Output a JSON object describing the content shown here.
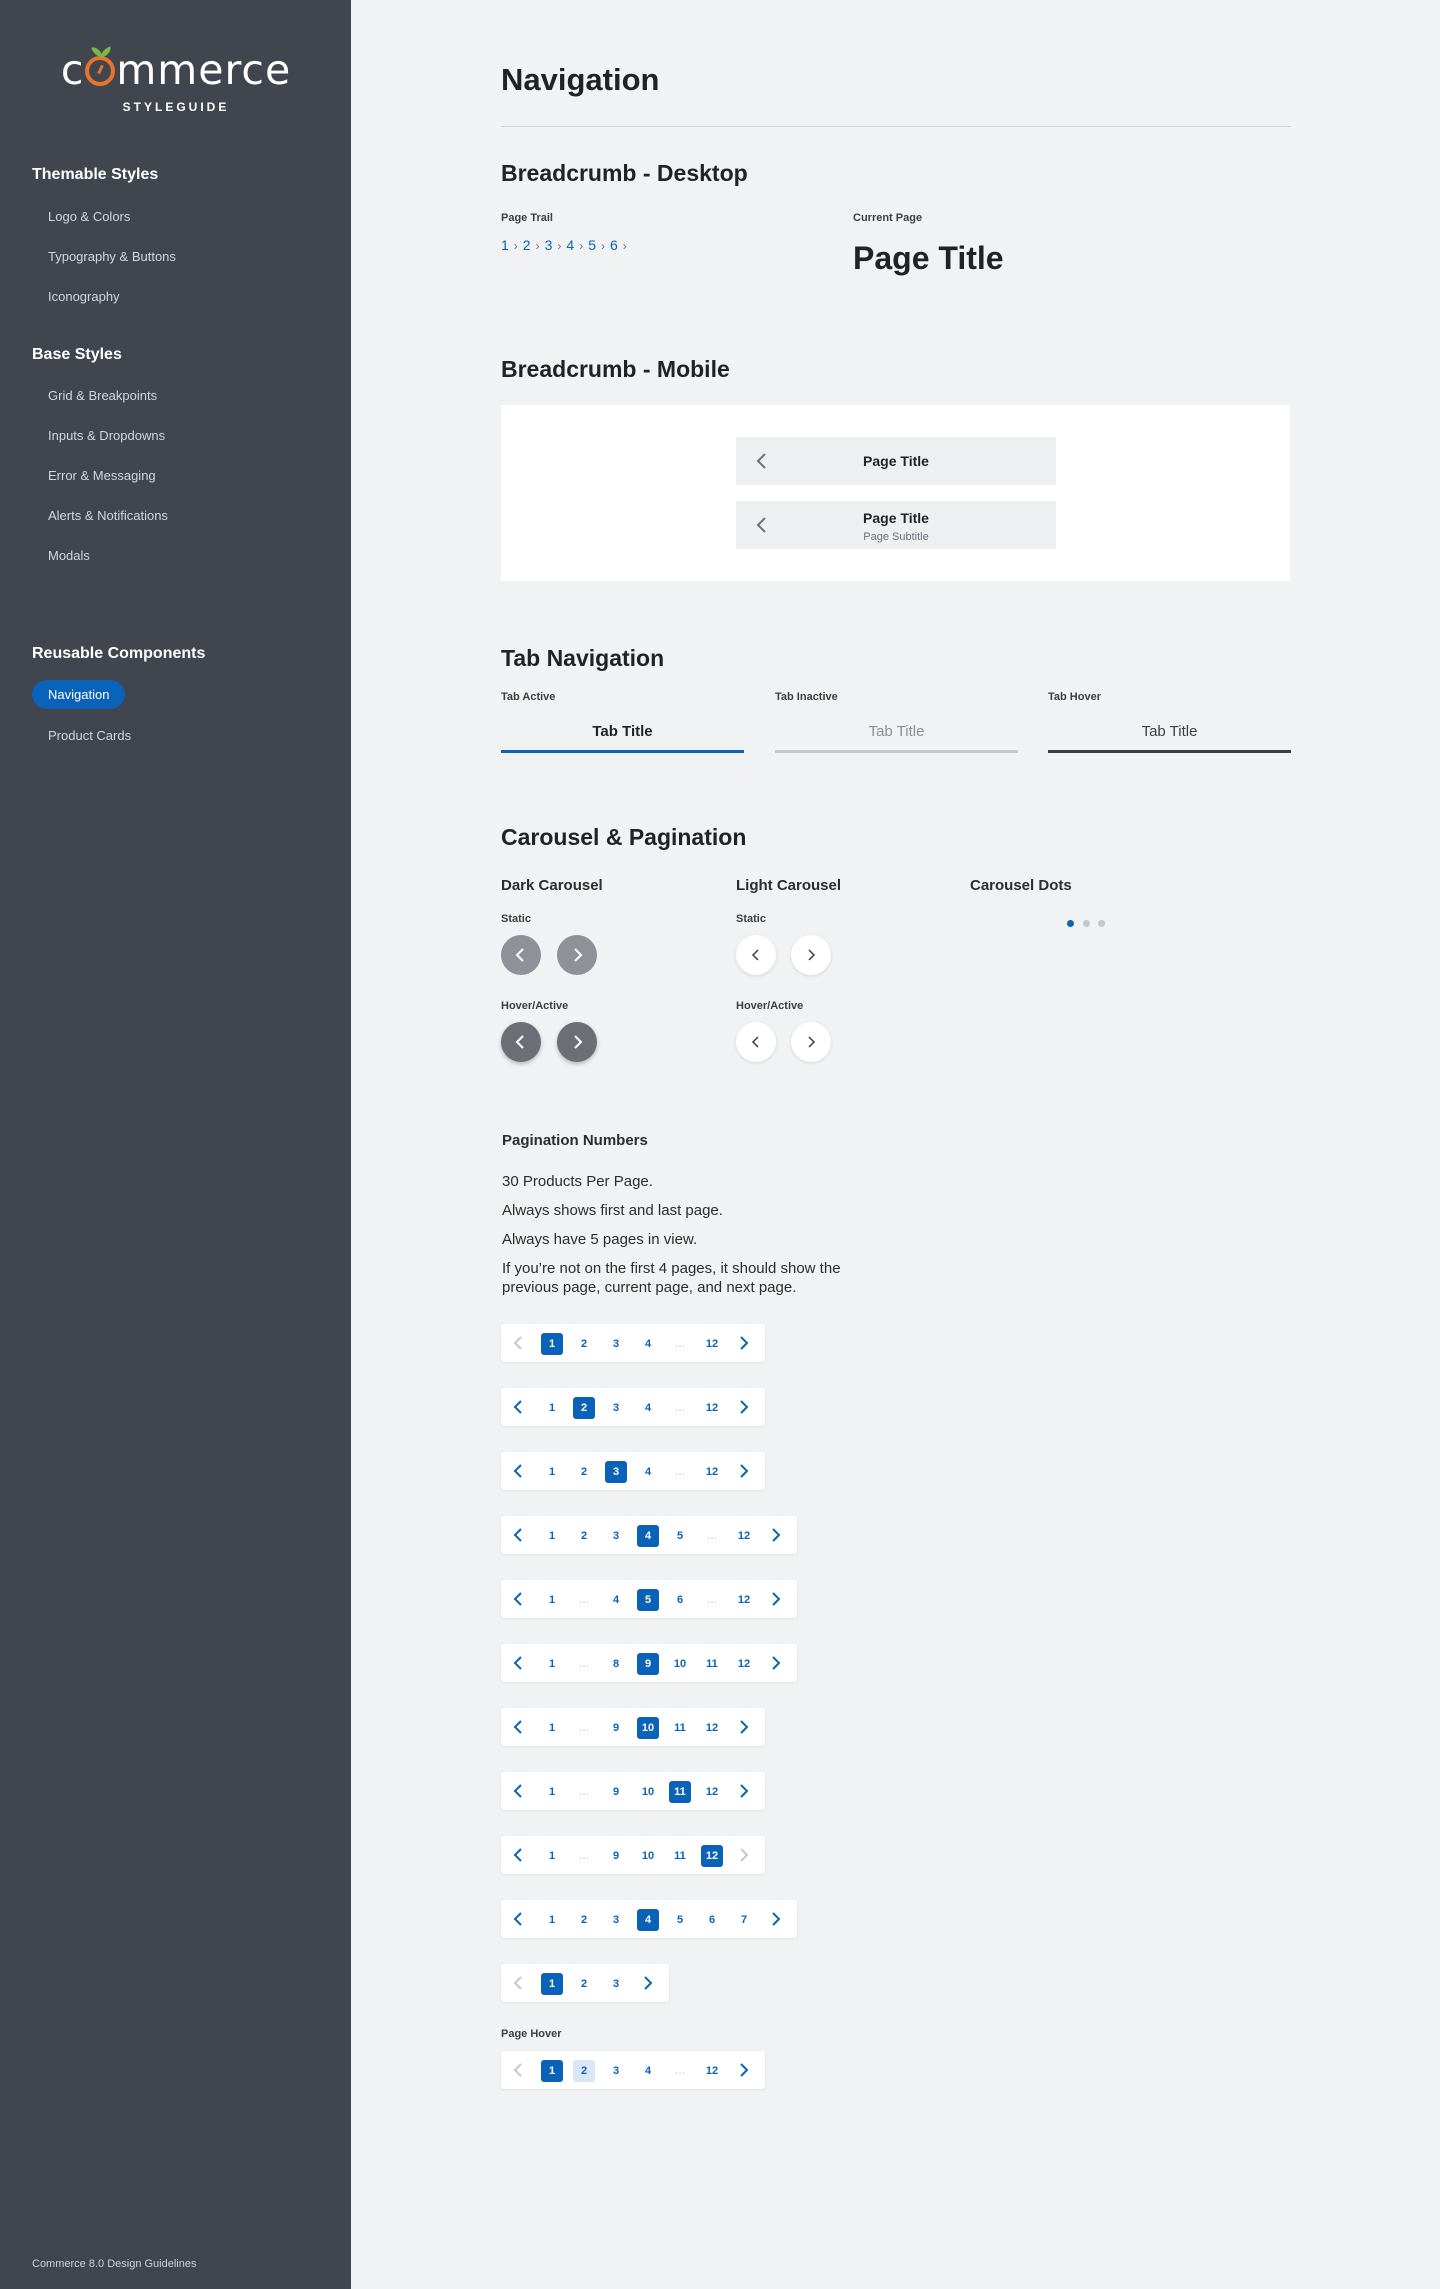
{
  "sidebar": {
    "logo_text_pre": "c",
    "logo_text_post": "mmerce",
    "logo_sub": "STYLEGUIDE",
    "sections": [
      {
        "heading": "Themable Styles",
        "items": [
          "Logo & Colors",
          "Typography & Buttons",
          "Iconography"
        ]
      },
      {
        "heading": "Base Styles",
        "items": [
          "Grid & Breakpoints",
          "Inputs & Dropdowns",
          "Error & Messaging",
          "Alerts & Notifications",
          "Modals"
        ]
      },
      {
        "heading": "Reusable Components",
        "items": [
          "Navigation",
          "Product Cards"
        ]
      }
    ],
    "active_item": "Navigation",
    "footer": "Commerce 8.0 Design Guidelines"
  },
  "page": {
    "title": "Navigation",
    "breadcrumb_desktop": {
      "heading": "Breadcrumb - Desktop",
      "trail_label": "Page Trail",
      "trail": [
        "1",
        "2",
        "3",
        "4",
        "5",
        "6"
      ],
      "current_label": "Current Page",
      "current_title": "Page Title"
    },
    "breadcrumb_mobile": {
      "heading": "Breadcrumb - Mobile",
      "bar1_title": "Page Title",
      "bar2_title": "Page Title",
      "bar2_subtitle": "Page Subtitle"
    },
    "tabs": {
      "heading": "Tab Navigation",
      "active_label": "Tab Active",
      "inactive_label": "Tab Inactive",
      "hover_label": "Tab Hover",
      "tab_title": "Tab Title"
    },
    "carousel": {
      "heading": "Carousel & Pagination",
      "dark_heading": "Dark Carousel",
      "light_heading": "Light Carousel",
      "dots_heading": "Carousel Dots",
      "static_label": "Static",
      "hover_label": "Hover/Active",
      "dots_active_index": 0,
      "dots_count": 3
    },
    "pagination": {
      "heading": "Pagination Numbers",
      "notes": [
        "30 Products Per Page.",
        "Always shows first and last page.",
        "Always have 5 pages in view.",
        "If you’re not on the first 4 pages, it should show the previous page, current page, and next page."
      ],
      "hover_label": "Page Hover",
      "rows": [
        {
          "pages": [
            "1",
            "2",
            "3",
            "4",
            "…",
            "12"
          ],
          "selected": "1",
          "prev_disabled": true,
          "next_disabled": false
        },
        {
          "pages": [
            "1",
            "2",
            "3",
            "4",
            "…",
            "12"
          ],
          "selected": "2",
          "prev_disabled": false,
          "next_disabled": false
        },
        {
          "pages": [
            "1",
            "2",
            "3",
            "4",
            "…",
            "12"
          ],
          "selected": "3",
          "prev_disabled": false,
          "next_disabled": false
        },
        {
          "pages": [
            "1",
            "2",
            "3",
            "4",
            "5",
            "…",
            "12"
          ],
          "selected": "4",
          "prev_disabled": false,
          "next_disabled": false
        },
        {
          "pages": [
            "1",
            "…",
            "4",
            "5",
            "6",
            "…",
            "12"
          ],
          "selected": "5",
          "prev_disabled": false,
          "next_disabled": false
        },
        {
          "pages": [
            "1",
            "…",
            "8",
            "9",
            "10",
            "11",
            "12"
          ],
          "selected": "9",
          "prev_disabled": false,
          "next_disabled": false
        },
        {
          "pages": [
            "1",
            "…",
            "9",
            "10",
            "11",
            "12"
          ],
          "selected": "10",
          "prev_disabled": false,
          "next_disabled": false
        },
        {
          "pages": [
            "1",
            "…",
            "9",
            "10",
            "11",
            "12"
          ],
          "selected": "11",
          "prev_disabled": false,
          "next_disabled": false
        },
        {
          "pages": [
            "1",
            "…",
            "9",
            "10",
            "11",
            "12"
          ],
          "selected": "12",
          "prev_disabled": false,
          "next_disabled": true
        },
        {
          "pages": [
            "1",
            "2",
            "3",
            "4",
            "5",
            "6",
            "7"
          ],
          "selected": "4",
          "prev_disabled": false,
          "next_disabled": false
        },
        {
          "pages": [
            "1",
            "2",
            "3"
          ],
          "selected": "1",
          "prev_disabled": true,
          "next_disabled": false
        }
      ],
      "hover_row": {
        "pages": [
          "1",
          "2",
          "3",
          "4",
          "…",
          "12"
        ],
        "selected": "1",
        "hovered": "2",
        "prev_disabled": true,
        "next_disabled": false
      }
    }
  },
  "colors": {
    "accent": "#0a63b8",
    "sidebar": "#41454d",
    "logo_orange": "#e8742c",
    "logo_leaf": "#7ab648",
    "dot_inactive": "#c4c7cc"
  }
}
